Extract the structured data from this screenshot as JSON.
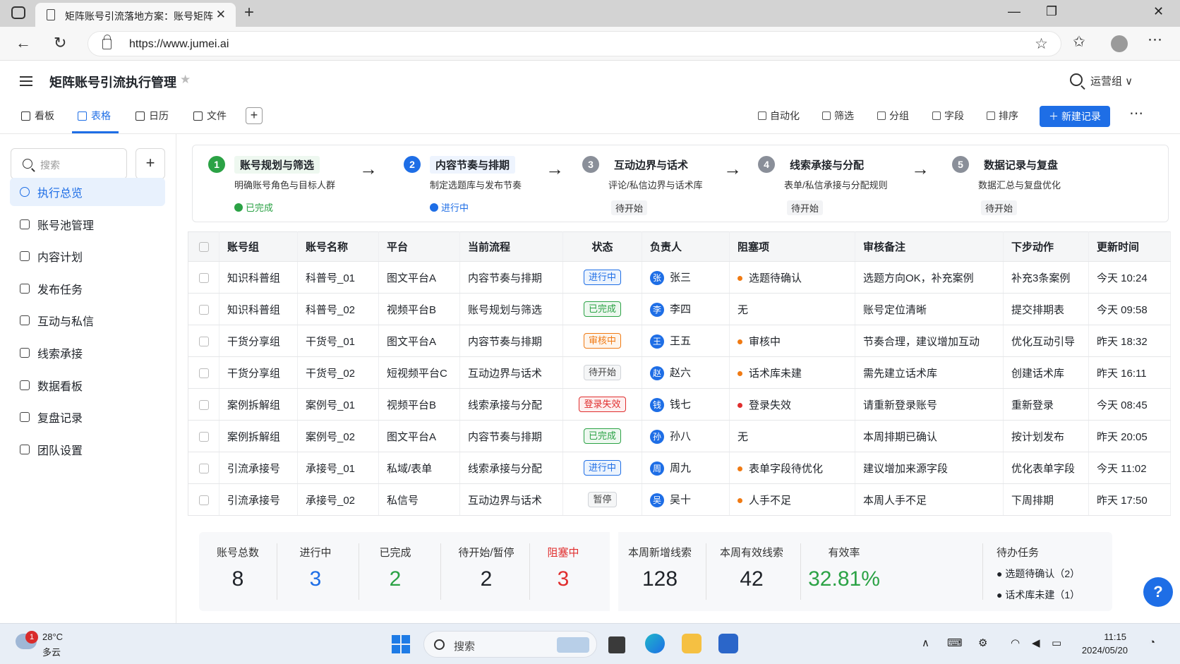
{
  "browser": {
    "tab_title": "矩阵账号引流落地方案：账号矩阵",
    "url": "https://www.jumei.ai"
  },
  "app": {
    "title": "矩阵账号引流执行管理",
    "group": "运营组 ∨"
  },
  "views": [
    "看板",
    "表格",
    "日历",
    "文件"
  ],
  "toolbar": {
    "automation": "自动化",
    "filter": "筛选",
    "group": "分组",
    "fields": "字段",
    "sort": "排序",
    "new_record": "新建记录"
  },
  "sidebar": {
    "search_placeholder": "搜索",
    "items": [
      "执行总览",
      "账号池管理",
      "内容计划",
      "发布任务",
      "互动与私信",
      "线索承接",
      "数据看板",
      "复盘记录",
      "团队设置"
    ]
  },
  "steps": [
    {
      "num": "1",
      "title": "账号规划与筛选",
      "desc": "明确账号角色与目标人群",
      "status": "已完成"
    },
    {
      "num": "2",
      "title": "内容节奏与排期",
      "desc": "制定选题库与发布节奏",
      "status": "进行中"
    },
    {
      "num": "3",
      "title": "互动边界与话术",
      "desc": "评论/私信边界与话术库",
      "status": "待开始"
    },
    {
      "num": "4",
      "title": "线索承接与分配",
      "desc": "表单/私信承接与分配规则",
      "status": "待开始"
    },
    {
      "num": "5",
      "title": "数据记录与复盘",
      "desc": "数据汇总与复盘优化",
      "status": "待开始"
    }
  ],
  "table": {
    "headers": [
      "账号组",
      "账号名称",
      "平台",
      "当前流程",
      "状态",
      "负责人",
      "阻塞项",
      "审核备注",
      "下步动作",
      "更新时间"
    ],
    "rows": [
      {
        "group": "知识科普组",
        "name": "科普号_01",
        "platform": "图文平台A",
        "flow": "内容节奏与排期",
        "status": "进行中",
        "owner_initial": "张",
        "owner": "张三",
        "block": "选题待确认",
        "note": "选题方向OK，补充案例",
        "next": "补充3条案例",
        "updated": "今天 10:24"
      },
      {
        "group": "知识科普组",
        "name": "科普号_02",
        "platform": "视频平台B",
        "flow": "账号规划与筛选",
        "status": "已完成",
        "owner_initial": "李",
        "owner": "李四",
        "block": "无",
        "note": "账号定位清晰",
        "next": "提交排期表",
        "updated": "今天 09:58"
      },
      {
        "group": "干货分享组",
        "name": "干货号_01",
        "platform": "图文平台A",
        "flow": "内容节奏与排期",
        "status": "审核中",
        "owner_initial": "王",
        "owner": "王五",
        "block": "审核中",
        "note": "节奏合理，建议增加互动",
        "next": "优化互动引导",
        "updated": "昨天 18:32"
      },
      {
        "group": "干货分享组",
        "name": "干货号_02",
        "platform": "短视频平台C",
        "flow": "互动边界与话术",
        "status": "待开始",
        "owner_initial": "赵",
        "owner": "赵六",
        "block": "话术库未建",
        "note": "需先建立话术库",
        "next": "创建话术库",
        "updated": "昨天 16:11"
      },
      {
        "group": "案例拆解组",
        "name": "案例号_01",
        "platform": "视频平台B",
        "flow": "线索承接与分配",
        "status": "登录失效",
        "owner_initial": "钱",
        "owner": "钱七",
        "block": "登录失效",
        "note": "请重新登录账号",
        "next": "重新登录",
        "updated": "今天 08:45"
      },
      {
        "group": "案例拆解组",
        "name": "案例号_02",
        "platform": "图文平台A",
        "flow": "内容节奏与排期",
        "status": "已完成",
        "owner_initial": "孙",
        "owner": "孙八",
        "block": "无",
        "note": "本周排期已确认",
        "next": "按计划发布",
        "updated": "昨天 20:05"
      },
      {
        "group": "引流承接号",
        "name": "承接号_01",
        "platform": "私域/表单",
        "flow": "线索承接与分配",
        "status": "进行中",
        "owner_initial": "周",
        "owner": "周九",
        "block": "表单字段待优化",
        "note": "建议增加来源字段",
        "next": "优化表单字段",
        "updated": "今天 11:02"
      },
      {
        "group": "引流承接号",
        "name": "承接号_02",
        "platform": "私信号",
        "flow": "互动边界与话术",
        "status": "暂停",
        "owner_initial": "吴",
        "owner": "吴十",
        "block": "人手不足",
        "note": "本周人手不足",
        "next": "下周排期",
        "updated": "昨天 17:50"
      }
    ]
  },
  "status_colors": {
    "进行中": "#1e6ee6",
    "已完成": "#2ba245",
    "审核中": "#f07a13",
    "待开始": "#666666",
    "登录失效": "#e02e2e",
    "暂停": "#666666"
  },
  "stats": [
    {
      "label": "账号总数",
      "value": "8"
    },
    {
      "label": "进行中",
      "value": "3"
    },
    {
      "label": "已完成",
      "value": "2"
    },
    {
      "label": "待开始/暂停",
      "value": "2"
    },
    {
      "label": "阻塞中",
      "value": "3"
    },
    {
      "label": "本周新增线索",
      "value": "128"
    },
    {
      "label": "本周有效线索",
      "value": "42"
    },
    {
      "label": "有效率",
      "value": "32.81%"
    }
  ],
  "todo": {
    "title": "待办任务",
    "items": [
      "选题待确认（2）",
      "话术库未建（1）"
    ]
  },
  "help": "?",
  "taskbar": {
    "badge": "1",
    "temperature": "28°C",
    "condition": "多云",
    "search_placeholder": "搜索",
    "time": "11:15",
    "date": "2024/05/20"
  }
}
